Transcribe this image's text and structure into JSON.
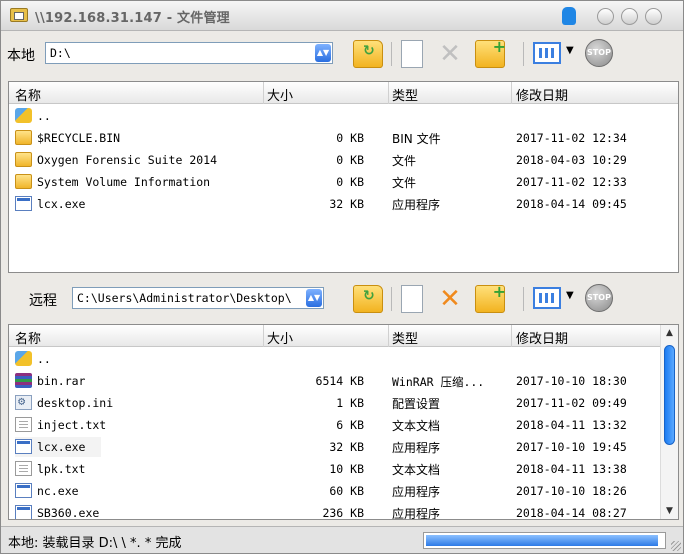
{
  "window": {
    "title": "\\\\192.168.31.147 - 文件管理"
  },
  "local": {
    "label": "本地",
    "path": "D:\\",
    "columns": [
      "名称",
      "大小",
      "类型",
      "修改日期"
    ],
    "files": [
      {
        "icon": "parent-dir-icon",
        "name": "..",
        "size": "",
        "type": "",
        "date": ""
      },
      {
        "icon": "folder-icon",
        "name": "$RECYCLE.BIN",
        "size": "0 KB",
        "type": "BIN 文件",
        "date": "2017-11-02 12:34"
      },
      {
        "icon": "folder-icon",
        "name": "Oxygen Forensic Suite 2014",
        "size": "0 KB",
        "type": "文件",
        "date": "2018-04-03 10:29"
      },
      {
        "icon": "folder-icon",
        "name": "System Volume Information",
        "size": "0 KB",
        "type": "文件",
        "date": "2017-11-02 12:33"
      },
      {
        "icon": "exe-icon",
        "name": "lcx.exe",
        "size": "32 KB",
        "type": "应用程序",
        "date": "2018-04-14 09:45"
      }
    ]
  },
  "remote": {
    "label": "远程",
    "path": "C:\\Users\\Administrator\\Desktop\\",
    "columns": [
      "名称",
      "大小",
      "类型",
      "修改日期"
    ],
    "files": [
      {
        "icon": "parent-dir-icon",
        "name": "..",
        "size": "",
        "type": "",
        "date": ""
      },
      {
        "icon": "rar-icon",
        "name": "bin.rar",
        "size": "6514 KB",
        "type": "WinRAR 压缩...",
        "date": "2017-10-10 18:30"
      },
      {
        "icon": "ini-icon",
        "name": "desktop.ini",
        "size": "1 KB",
        "type": "配置设置",
        "date": "2017-11-02 09:49"
      },
      {
        "icon": "txt-icon",
        "name": "inject.txt",
        "size": "6 KB",
        "type": "文本文档",
        "date": "2018-04-11 13:32"
      },
      {
        "icon": "exe-icon",
        "name": "lcx.exe",
        "size": "32 KB",
        "type": "应用程序",
        "date": "2017-10-10 19:45"
      },
      {
        "icon": "txt-icon",
        "name": "lpk.txt",
        "size": "10 KB",
        "type": "文本文档",
        "date": "2018-04-11 13:38"
      },
      {
        "icon": "exe-icon",
        "name": "nc.exe",
        "size": "60 KB",
        "type": "应用程序",
        "date": "2017-10-10 18:26"
      },
      {
        "icon": "exe-icon",
        "name": "SB360.exe",
        "size": "236 KB",
        "type": "应用程序",
        "date": "2018-04-14 08:27"
      }
    ]
  },
  "toolbar": {
    "stop_label": "STOP"
  },
  "status": {
    "text": "本地: 装载目录 D:\\ \\ *. * 完成",
    "progress": 0.98
  }
}
